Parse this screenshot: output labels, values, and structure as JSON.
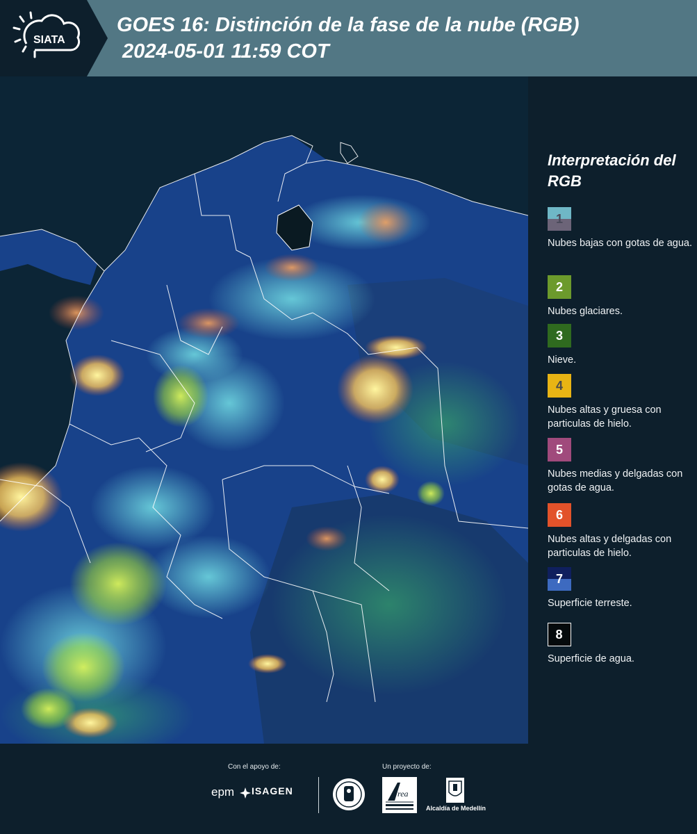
{
  "header": {
    "logo_text": "SIATA",
    "title": "GOES 16: Distinción de la fase de la nube (RGB)",
    "subtitle": "2024-05-01 11:59 COT"
  },
  "legend": {
    "title": "Interpretación del RGB",
    "items": [
      {
        "number": "1",
        "label": "Nubes bajas con gotas de agua.",
        "colors": [
          "#6fb7c6",
          "#6c6478"
        ],
        "number_color": "#4a4a5a"
      },
      {
        "number": "2",
        "label": "Nubes glaciares.",
        "colors": [
          "#6c9a2c"
        ],
        "number_color": "#ffffff"
      },
      {
        "number": "3",
        "label": "Nieve.",
        "colors": [
          "#2f6a1f"
        ],
        "number_color": "#ffffff"
      },
      {
        "number": "4",
        "label": "Nubes altas y gruesa con particulas de hielo.",
        "colors": [
          "#e8b414"
        ],
        "number_color": "#4a4a4a"
      },
      {
        "number": "5",
        "label": "Nubes medias y delgadas con gotas de agua.",
        "colors": [
          "#a04a7c"
        ],
        "number_color": "#ffffff"
      },
      {
        "number": "6",
        "label": "Nubes altas y delgadas con particulas de hielo.",
        "colors": [
          "#e2522a"
        ],
        "number_color": "#ffffff"
      },
      {
        "number": "7",
        "label": "Superficie terreste.",
        "colors": [
          "#0f1f5e",
          "#3d6ac0"
        ],
        "number_color": "#ffffff"
      },
      {
        "number": "8",
        "label": "Superficie de agua.",
        "colors": [
          "#050a0c"
        ],
        "number_color": "#ffffff"
      }
    ]
  },
  "footer": {
    "support_label": "Con el apoyo de:",
    "project_label": "Un proyecto de:",
    "sponsors": [
      "epm",
      "ISAGEN"
    ],
    "partners": [
      "Área Metropolitana Valle de Aburrá",
      "Alcaldía de Medellín"
    ],
    "alcaldia_text": "Alcaldía de Medellín"
  }
}
